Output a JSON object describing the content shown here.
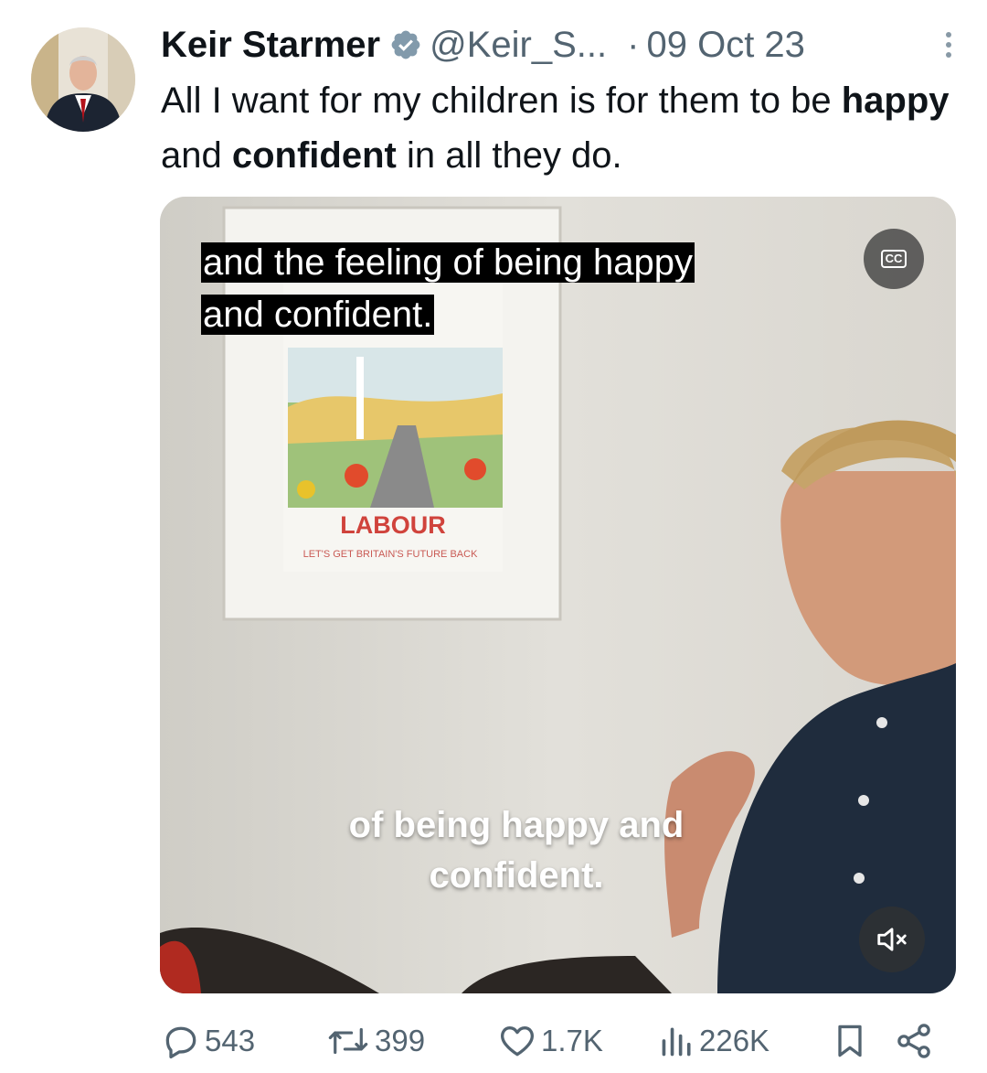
{
  "tweet": {
    "author_name": "Keir Starmer",
    "handle": "@Keir_S...",
    "separator": "·",
    "date": "09 Oct 23",
    "text_part1": "All I want for my children is for them to be ",
    "text_bold1": "happy",
    "text_part2": " and ",
    "text_bold2": "confident",
    "text_part3": " in all they do."
  },
  "media": {
    "caption_line1": "and the feeling of being happy",
    "caption_line2": "and confident.",
    "cc_label": "CC",
    "burned_caption_line1": "of being happy and",
    "burned_caption_line2": "confident.",
    "poster_title": "LABOUR",
    "poster_subtitle": "LET'S GET BRITAIN'S FUTURE BACK"
  },
  "actions": {
    "replies": "543",
    "reposts": "399",
    "likes": "1.7K",
    "views": "226K"
  },
  "colors": {
    "text": "#0f1419",
    "secondary": "#536471",
    "verified": "#829aab",
    "labour_red": "#d50000"
  }
}
